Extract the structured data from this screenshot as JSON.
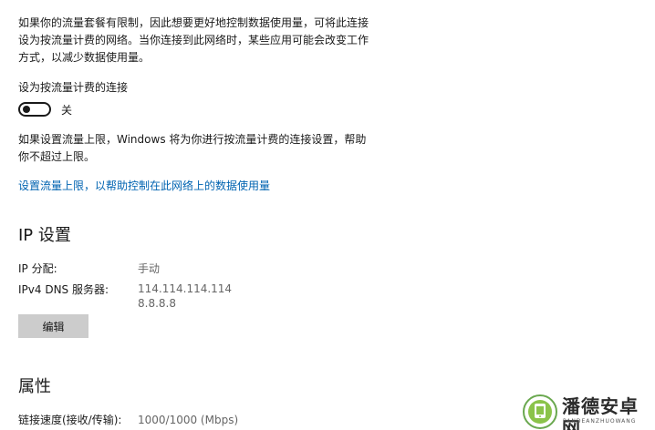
{
  "metered": {
    "description": "如果你的流量套餐有限制，因此想要更好地控制数据使用量，可将此连接设为按流量计费的网络。当你连接到此网络时，某些应用可能会改变工作方式，以减少数据使用量。",
    "toggle_label": "设为按流量计费的连接",
    "toggle_state": "关",
    "limit_note": "如果设置流量上限，Windows 将为你进行按流量计费的连接设置，帮助你不超过上限。",
    "limit_link": "设置流量上限，以帮助控制在此网络上的数据使用量"
  },
  "ip_settings": {
    "heading": "IP 设置",
    "assignment_label": "IP 分配:",
    "assignment_value": "手动",
    "dns_label": "IPv4 DNS 服务器:",
    "dns_primary": "114.114.114.114",
    "dns_secondary": "8.8.8.8",
    "edit_button": "编辑"
  },
  "properties": {
    "heading": "属性",
    "link_speed_label": "链接速度(接收/传输):",
    "link_speed_value": "1000/1000 (Mbps)"
  },
  "watermark": {
    "brand": "潘德安卓网",
    "sub": "PANDEANZHUOWANG"
  },
  "colors": {
    "link": "#0063b1",
    "button_bg": "#cccccc",
    "value_text": "#666666"
  }
}
